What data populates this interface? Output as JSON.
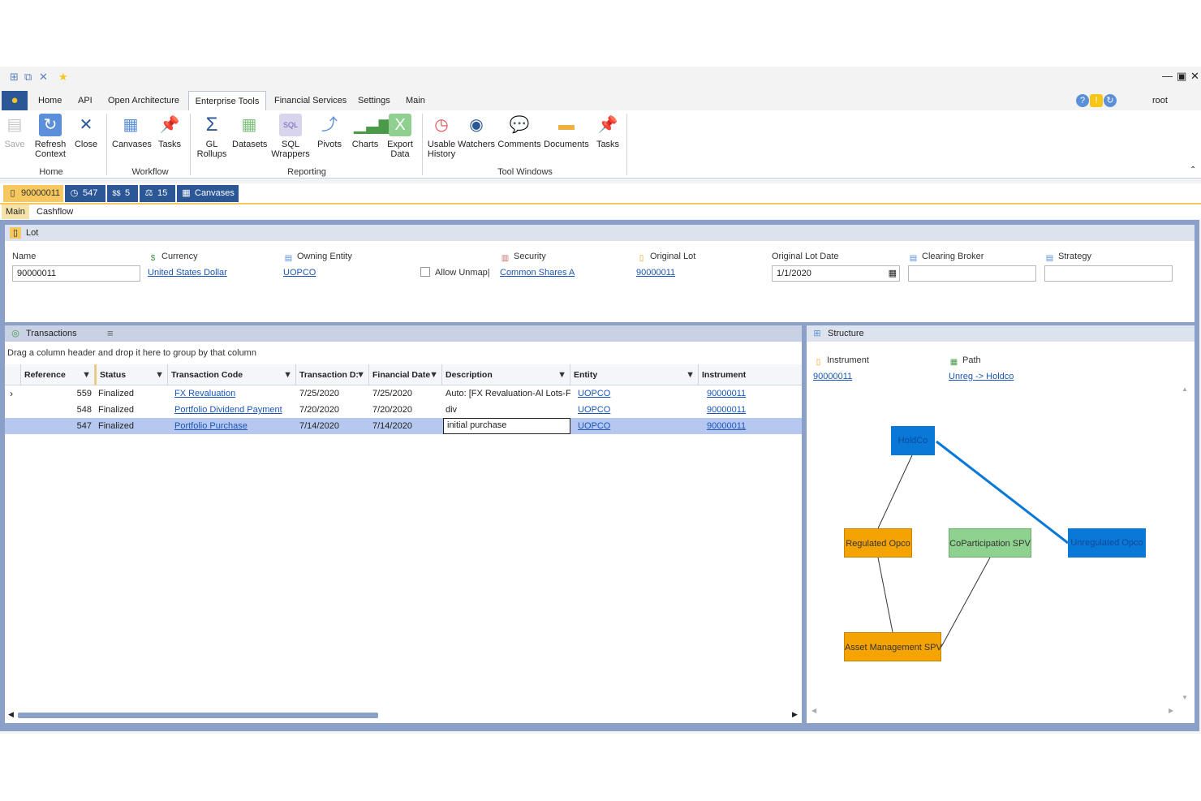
{
  "user": "root",
  "menu_tabs": [
    "Home",
    "API",
    "Open Architecture",
    "Enterprise Tools",
    "Financial Services",
    "Settings",
    "Main"
  ],
  "ribbon": {
    "home": {
      "save": "Save",
      "refresh_1": "Refresh",
      "refresh_2": "Context",
      "close": "Close",
      "group": "Home"
    },
    "workflow": {
      "canvases": "Canvases",
      "tasks": "Tasks",
      "group": "Workflow"
    },
    "reporting": {
      "gl_1": "GL",
      "gl_2": "Rollups",
      "datasets": "Datasets",
      "sql_1": "SQL",
      "sql_2": "Wrappers",
      "pivots": "Pivots",
      "charts": "Charts",
      "export_1": "Export",
      "export_2": "Data",
      "group": "Reporting"
    },
    "tool_windows": {
      "usable_1": "Usable",
      "usable_2": "History",
      "watchers": "Watchers",
      "comments": "Comments",
      "documents": "Documents",
      "tasks": "Tasks",
      "group": "Tool Windows"
    }
  },
  "context_chips": {
    "lot": "90000011",
    "history": "547",
    "dollars": "5",
    "scale": "15",
    "canvases": "Canvases"
  },
  "doc_tabs": {
    "main": "Main",
    "cashflow": "Cashflow"
  },
  "lot_panel": {
    "title": "Lot",
    "name_label": "Name",
    "name_value": "90000011",
    "currency_label": "Currency",
    "currency_value": "United States Dollar",
    "owning_entity_label": "Owning Entity",
    "owning_entity_value": "UOPCO",
    "allow_unmap_label": "Allow Unmap|",
    "security_label": "Security",
    "security_value": "Common Shares A",
    "original_lot_label": "Original Lot",
    "original_lot_value": "90000011",
    "original_lot_date_label": "Original Lot Date",
    "original_lot_date_value": "1/1/2020",
    "clearing_broker_label": "Clearing Broker",
    "strategy_label": "Strategy"
  },
  "transactions": {
    "title": "Transactions",
    "hint": "Drag a column header and drop it here to group by that column",
    "columns": [
      "Reference",
      "Status",
      "Transaction Code",
      "Transaction D:",
      "Financial Date",
      "Description",
      "Entity",
      "Instrument"
    ],
    "rows": [
      {
        "reference": "559",
        "status": "Finalized",
        "code": "FX Revaluation",
        "tdate": "7/25/2020",
        "fdate": "7/25/2020",
        "description": "Auto: [FX Revaluation-Al Lots-F",
        "entity": "UOPCO",
        "instrument": "90000011"
      },
      {
        "reference": "548",
        "status": "Finalized",
        "code": "Portfolio Dividend Payment",
        "tdate": "7/20/2020",
        "fdate": "7/20/2020",
        "description": "div",
        "entity": "UOPCO",
        "instrument": "90000011"
      },
      {
        "reference": "547",
        "status": "Finalized",
        "code": "Portfolio Purchase",
        "tdate": "7/14/2020",
        "fdate": "7/14/2020",
        "description": "initial purchase",
        "entity": "UOPCO",
        "instrument": "90000011"
      }
    ]
  },
  "structure": {
    "title": "Structure",
    "instrument_label": "Instrument",
    "instrument_value": "90000011",
    "path_label": "Path",
    "path_value": "Unreg -> Holdco",
    "nodes": {
      "holdco": "HoldCo",
      "regulated": "Regulated Opco",
      "coparticipation": "CoParticipation SPV",
      "unregulated": "Unregulated Opco",
      "asset_mgmt": "Asset Management SPV"
    },
    "colors": {
      "blue": "#0a78d7",
      "orange": "#f5a300",
      "green": "#8fd18f"
    }
  }
}
